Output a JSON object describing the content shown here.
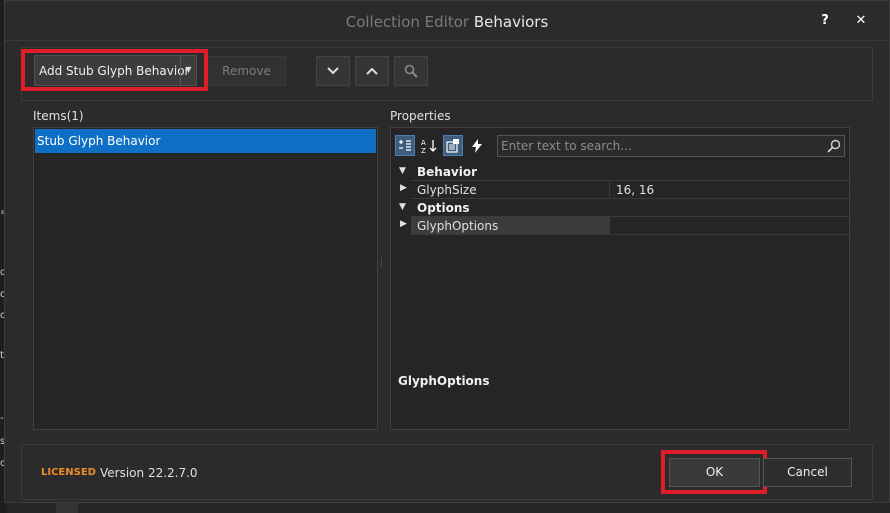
{
  "window": {
    "title_prefix": "Collection Editor",
    "title_main": "Behaviors",
    "help_label": "?",
    "close_label": "✕"
  },
  "toolbar": {
    "add_label": "Add Stub Glyph Behavior",
    "remove_label": "Remove",
    "move_down_icon": "chevron-down-icon",
    "move_up_icon": "chevron-up-icon",
    "search_icon": "magnifier-icon"
  },
  "items": {
    "label": "Items(1)",
    "list": [
      "Stub Glyph Behavior"
    ]
  },
  "properties": {
    "label": "Properties",
    "search_placeholder": "Enter text to search...",
    "categories": [
      {
        "name": "Behavior",
        "rows": [
          {
            "name": "GlyphSize",
            "value": "16, 16"
          }
        ]
      },
      {
        "name": "Options",
        "rows": [
          {
            "name": "GlyphOptions",
            "value": ""
          }
        ]
      }
    ],
    "description_title": "GlyphOptions"
  },
  "footer": {
    "licensed": "LICENSED",
    "version": "Version 22.2.7.0",
    "ok_label": "OK",
    "cancel_label": "Cancel"
  },
  "colors": {
    "highlight": "#e01e2a",
    "selection": "#0e6fc4",
    "licensed": "#f08c24"
  }
}
